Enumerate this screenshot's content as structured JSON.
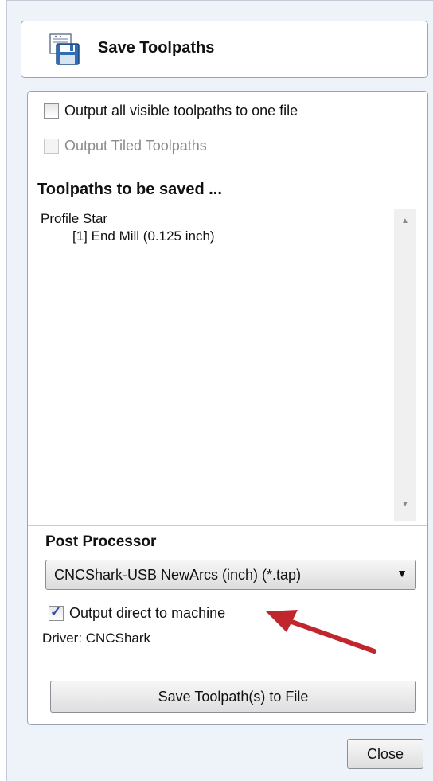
{
  "header": {
    "title": "Save Toolpaths",
    "icon": "floppy-disk-icon"
  },
  "options": {
    "output_all_label": "Output all visible toolpaths to one file",
    "output_all_checked": false,
    "output_tiled_label": "Output Tiled Toolpaths",
    "output_tiled_enabled": false
  },
  "toolpaths": {
    "section_title": "Toolpaths to be saved ...",
    "items": [
      {
        "label": "Profile Star"
      },
      {
        "label": "[1] End Mill (0.125 inch)"
      }
    ]
  },
  "post_processor": {
    "section_title": "Post Processor",
    "selected": "CNCShark-USB NewArcs (inch) (*.tap)",
    "output_direct_label": "Output direct to machine",
    "output_direct_checked": true,
    "driver_text": "Driver: CNCShark"
  },
  "buttons": {
    "save_label": "Save Toolpath(s) to File",
    "close_label": "Close"
  },
  "colors": {
    "annotation_arrow": "#c0262c",
    "checkmark": "#2b4fa0"
  }
}
